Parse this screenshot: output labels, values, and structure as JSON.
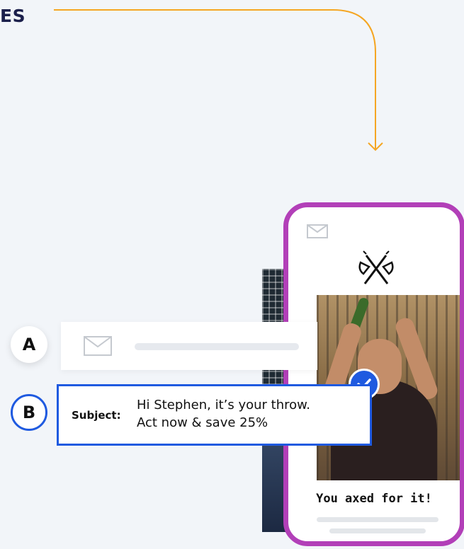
{
  "heading_fragment": "ES",
  "variants": {
    "a_label": "A",
    "b_label": "B"
  },
  "variant_b": {
    "subject_label": "Subject:",
    "subject_line_1": "Hi Stephen, it’s your throw.",
    "subject_line_2": "Act now & save 25%"
  },
  "phone": {
    "tagline": "You axed for it!"
  },
  "icons": {
    "mail": "mail-icon",
    "logo": "crossed-axes-icon",
    "check": "check-icon",
    "arrow": "arrow-down-icon"
  },
  "colors": {
    "accent_orange": "#f5a623",
    "accent_blue": "#1f5ae0",
    "phone_border": "#b23fb8",
    "heading": "#1b1f4b"
  }
}
